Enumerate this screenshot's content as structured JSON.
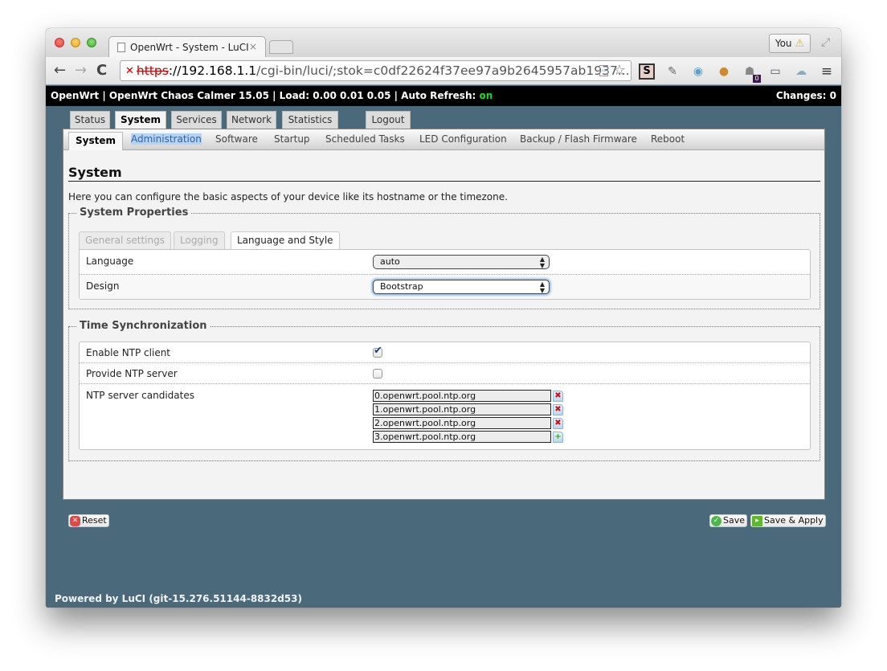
{
  "browser": {
    "tab_title": "OpenWrt - System - LuCI",
    "tab_close": "×",
    "profile_button": "You",
    "url_scheme": "https",
    "url_host": "://192.168.1.1",
    "url_path": "/cgi-bin/luci/;stok=c0df22624f37ee97a9b2645957ab1937...",
    "icons": {
      "back": "←",
      "forward": "→",
      "reload": "C",
      "star": "☆",
      "menu": "≡",
      "warning": "⚠",
      "fullscreen": "⤢",
      "lock_broken": "✕",
      "ext_s": "S",
      "ext_notebook": "✎",
      "ext_camera": "◉",
      "ext_cookie": "●",
      "ext_ghost": "☗",
      "ext_ghost_badge": "0",
      "ext_cast": "▭",
      "ext_cloud": "☁"
    }
  },
  "header": {
    "info_prefix": "OpenWrt | OpenWrt Chaos Calmer 15.05 | Load: 0.00 0.01 0.05 | Auto Refresh: ",
    "auto_refresh": "on",
    "changes": "Changes: 0"
  },
  "main_tabs": [
    {
      "label": "Status"
    },
    {
      "label": "System",
      "active": true
    },
    {
      "label": "Services"
    },
    {
      "label": "Network"
    },
    {
      "label": "Statistics"
    },
    {
      "label": "Logout"
    }
  ],
  "sub_tabs": [
    {
      "label": "System",
      "active": true
    },
    {
      "label": "Administration",
      "highlighted": true
    },
    {
      "label": "Software"
    },
    {
      "label": "Startup"
    },
    {
      "label": "Scheduled Tasks"
    },
    {
      "label": "LED Configuration"
    },
    {
      "label": "Backup / Flash Firmware"
    },
    {
      "label": "Reboot"
    }
  ],
  "page": {
    "title": "System",
    "description": "Here you can configure the basic aspects of your device like its hostname or the timezone."
  },
  "system_properties": {
    "legend": "System Properties",
    "tabs": [
      {
        "label": "General settings",
        "active": false
      },
      {
        "label": "Logging",
        "active": false
      },
      {
        "label": "Language and Style",
        "active": true
      }
    ],
    "fields": {
      "language": {
        "label": "Language",
        "value": "auto"
      },
      "design": {
        "label": "Design",
        "value": "Bootstrap"
      }
    }
  },
  "time_sync": {
    "legend": "Time Synchronization",
    "enable_ntp_client": {
      "label": "Enable NTP client",
      "checked": true
    },
    "provide_ntp_server": {
      "label": "Provide NTP server",
      "checked": false
    },
    "ntp_candidates": {
      "label": "NTP server candidates",
      "servers": [
        "0.openwrt.pool.ntp.org",
        "1.openwrt.pool.ntp.org",
        "2.openwrt.pool.ntp.org",
        "3.openwrt.pool.ntp.org"
      ],
      "remove_icon": "✖",
      "add_icon": "+"
    }
  },
  "actions": {
    "reset": "Reset",
    "save": "Save",
    "save_apply": "Save & Apply",
    "reset_icon": "✕",
    "save_icon": "✓",
    "apply_icon": "▸"
  },
  "footer": "Powered by LuCI (git-15.276.51144-8832d53)",
  "colors": {
    "page_background": "#4a6a7c",
    "header_background": "#000000",
    "auto_refresh_on": "#1ddd1d",
    "highlight": "#b5d3f3"
  }
}
